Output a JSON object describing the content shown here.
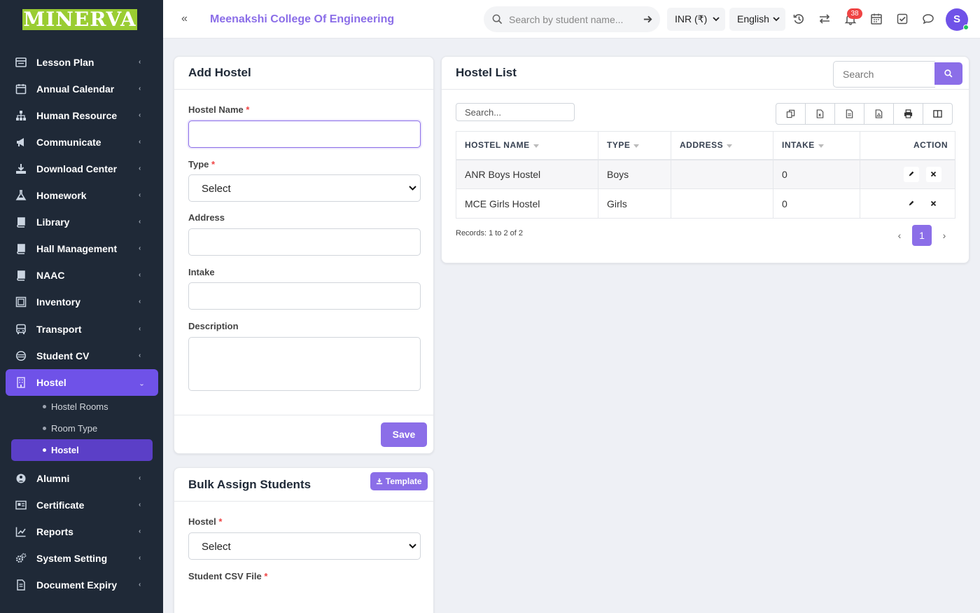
{
  "brand": {
    "logo": "MINERVA"
  },
  "sidebar": {
    "items": [
      {
        "label": "Lesson Plan",
        "icon": "lesson-plan-icon"
      },
      {
        "label": "Annual Calendar",
        "icon": "calendar-icon"
      },
      {
        "label": "Human Resource",
        "icon": "sitemap-icon"
      },
      {
        "label": "Communicate",
        "icon": "megaphone-icon"
      },
      {
        "label": "Download Center",
        "icon": "download-icon"
      },
      {
        "label": "Homework",
        "icon": "flask-icon"
      },
      {
        "label": "Library",
        "icon": "book-icon"
      },
      {
        "label": "Hall Management",
        "icon": "book-icon"
      },
      {
        "label": "NAAC",
        "icon": "book-icon"
      },
      {
        "label": "Inventory",
        "icon": "inventory-icon"
      },
      {
        "label": "Transport",
        "icon": "bus-icon"
      },
      {
        "label": "Student CV",
        "icon": "cv-icon"
      },
      {
        "label": "Hostel",
        "icon": "building-icon"
      },
      {
        "label": "Alumni",
        "icon": "alumni-icon"
      },
      {
        "label": "Certificate",
        "icon": "certificate-icon"
      },
      {
        "label": "Reports",
        "icon": "chart-line-icon"
      },
      {
        "label": "System Setting",
        "icon": "gears-icon"
      },
      {
        "label": "Document Expiry",
        "icon": "document-icon"
      }
    ],
    "hostel_sub": [
      {
        "label": "Hostel Rooms"
      },
      {
        "label": "Room Type"
      },
      {
        "label": "Hostel"
      }
    ]
  },
  "header": {
    "college": "Meenakshi College Of Engineering",
    "search_placeholder": "Search by student name...",
    "currency": "INR (₹)",
    "language": "English",
    "notifications": "38",
    "avatar": "S"
  },
  "add_hostel": {
    "title": "Add Hostel",
    "name_label": "Hostel Name",
    "type_label": "Type",
    "type_value": "Select",
    "address_label": "Address",
    "intake_label": "Intake",
    "description_label": "Description",
    "required": "*",
    "save": "Save"
  },
  "bulk": {
    "title": "Bulk Assign Students",
    "template": "Template",
    "hostel_label": "Hostel",
    "hostel_value": "Select",
    "csv_label": "Student CSV File",
    "required": "*"
  },
  "hostel_list": {
    "title": "Hostel List",
    "search_placeholder": "Search",
    "table_search": "Search...",
    "columns": [
      "HOSTEL NAME",
      "TYPE",
      "ADDRESS",
      "INTAKE",
      "ACTION"
    ],
    "rows": [
      {
        "name": "ANR Boys Hostel",
        "type": "Boys",
        "address": "",
        "intake": "0"
      },
      {
        "name": "MCE Girls Hostel",
        "type": "Girls",
        "address": "",
        "intake": "0"
      }
    ],
    "records": "Records: 1 to 2 of 2",
    "page": "1",
    "prev": "‹",
    "next": "›"
  },
  "colors": {
    "accent": "#8b6ee8",
    "sidebar": "#1f2937",
    "active": "#6f52e8",
    "badge": "#ef4444"
  }
}
